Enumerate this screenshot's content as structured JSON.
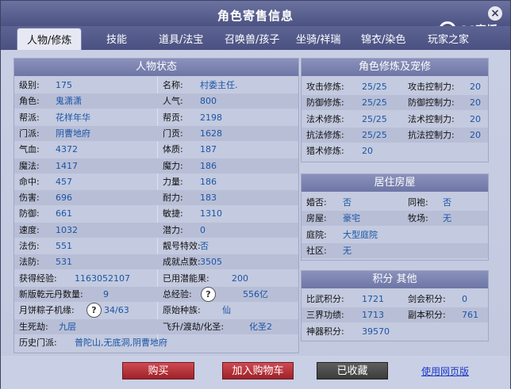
{
  "window": {
    "title": "角色寄售信息",
    "close_icon": "×"
  },
  "logo": {
    "text": "CC直播"
  },
  "tabs": [
    "人物/修炼",
    "技能",
    "道具/法宝",
    "召唤兽/孩子",
    "坐骑/祥瑞",
    "锦衣/染色",
    "玩家之家"
  ],
  "status": {
    "title": "人物状态",
    "rows": [
      {
        "l1": "级别:",
        "v1": "175",
        "l2": "名称:",
        "v2": "村委主任."
      },
      {
        "l1": "角色:",
        "v1": "鬼潇潇",
        "l2": "人气:",
        "v2": "800"
      },
      {
        "l1": "帮派:",
        "v1": "花样年华",
        "l2": "帮贡:",
        "v2": "2198"
      },
      {
        "l1": "门派:",
        "v1": "阴曹地府",
        "l2": "门贡:",
        "v2": "1628"
      },
      {
        "l1": "气血:",
        "v1": "4372",
        "l2": "体质:",
        "v2": "187"
      },
      {
        "l1": "魔法:",
        "v1": "1417",
        "l2": "魔力:",
        "v2": "186"
      },
      {
        "l1": "命中:",
        "v1": "457",
        "l2": "力量:",
        "v2": "186"
      },
      {
        "l1": "伤害:",
        "v1": "696",
        "l2": "耐力:",
        "v2": "183"
      },
      {
        "l1": "防御:",
        "v1": "661",
        "l2": "敏捷:",
        "v2": "1310"
      },
      {
        "l1": "速度:",
        "v1": "1032",
        "l2": "潜力:",
        "v2": "0"
      },
      {
        "l1": "法伤:",
        "v1": "551",
        "l2": "靓号特效:",
        "v2": "否"
      },
      {
        "l1": "法防:",
        "v1": "531",
        "l2": "成就点数:",
        "v2": "3505"
      },
      {
        "l1": "获得经验:",
        "v1": "1163052107",
        "l2": "已用潜能果:",
        "v2": "200"
      },
      {
        "l1": "新版乾元丹数量:",
        "v1": "9",
        "l2": "总经验:",
        "v2": "556亿"
      },
      {
        "l1": "月饼粽子机缘:",
        "v1": "34/63",
        "l2": "原始种族:",
        "v2": "仙"
      },
      {
        "l1": "生死劫:",
        "v1": "九层",
        "l2": "飞升/渡劫/化圣:",
        "v2": "化圣2"
      },
      {
        "l1": "历史门派:",
        "v1": "普陀山,无底洞,阴曹地府",
        "l2": "",
        "v2": ""
      }
    ]
  },
  "cultivation": {
    "title": "角色修炼及宠修",
    "rows": [
      {
        "l1": "攻击修炼:",
        "v1": "25/25",
        "l2": "攻击控制力:",
        "v2": "20"
      },
      {
        "l1": "防御修炼:",
        "v1": "25/25",
        "l2": "防御控制力:",
        "v2": "20"
      },
      {
        "l1": "法术修炼:",
        "v1": "25/25",
        "l2": "法术控制力:",
        "v2": "20"
      },
      {
        "l1": "抗法修炼:",
        "v1": "25/25",
        "l2": "抗法控制力:",
        "v2": "20"
      },
      {
        "l1": "猎术修炼:",
        "v1": "20",
        "l2": "",
        "v2": ""
      }
    ]
  },
  "house": {
    "title": "居住房屋",
    "rows": [
      {
        "l1": "婚否:",
        "v1": "否",
        "l2": "同袍:",
        "v2": "否"
      },
      {
        "l1": "房屋:",
        "v1": "豪宅",
        "l2": "牧场:",
        "v2": "无"
      },
      {
        "l1": "庭院:",
        "v1": "大型庭院",
        "l2": "",
        "v2": ""
      },
      {
        "l1": "社区:",
        "v1": "无",
        "l2": "",
        "v2": ""
      }
    ]
  },
  "points": {
    "title": "积分 其他",
    "rows": [
      {
        "l1": "比武积分:",
        "v1": "1721",
        "l2": "剑会积分:",
        "v2": "0"
      },
      {
        "l1": "三界功绩:",
        "v1": "1713",
        "l2": "副本积分:",
        "v2": "761"
      },
      {
        "l1": "神器积分:",
        "v1": "39570",
        "l2": "",
        "v2": ""
      }
    ]
  },
  "help_icon": "?",
  "buttons": {
    "buy": "购买",
    "cart": "加入购物车",
    "fav": "已收藏",
    "web": "使用网页版"
  },
  "colors": {
    "header": "#6e76a6",
    "value": "#1a55a6",
    "buy": "#b8323a"
  }
}
